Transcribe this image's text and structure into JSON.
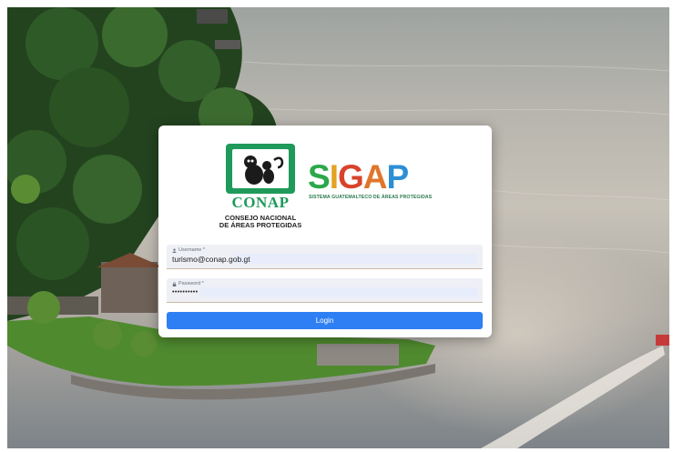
{
  "logo": {
    "brand": "CONAP",
    "subtitle_line1": "CONSEJO NACIONAL",
    "subtitle_line2": "DE ÁREAS PROTEGIDAS",
    "sigap_letters": [
      "S",
      "I",
      "G",
      "A",
      "P"
    ],
    "sigap_colors": [
      "#2ba84a",
      "#e3a322",
      "#d8432b",
      "#e0762b",
      "#2c8fd6"
    ],
    "sigap_tagline": "SISTEMA GUATEMALTECO DE ÁREAS PROTEGIDAS"
  },
  "form": {
    "username": {
      "label": "Username *",
      "value": "turismo@conap.gob.gt",
      "icon": "user-icon"
    },
    "password": {
      "label": "Password *",
      "value": "••••••••••",
      "icon": "lock-icon"
    },
    "login_label": "Login"
  },
  "colors": {
    "accent": "#2e7ff3",
    "conap_green": "#1f9a5a"
  }
}
